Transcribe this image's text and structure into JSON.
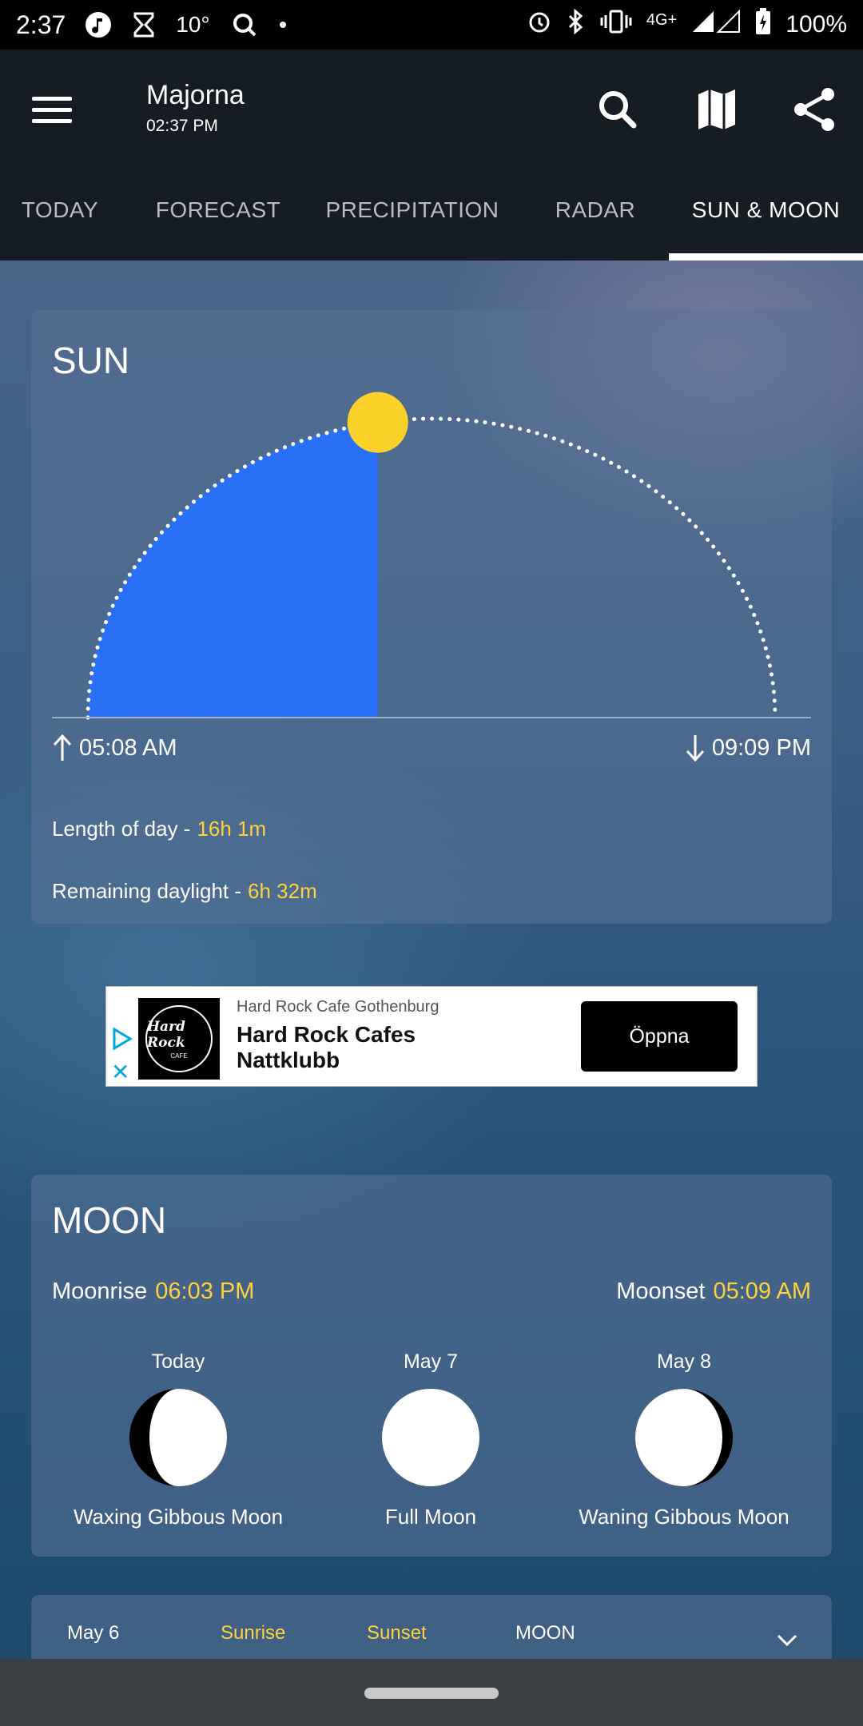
{
  "status_bar": {
    "time": "2:37",
    "temp": "10°",
    "network": "4G+",
    "battery": "100%"
  },
  "header": {
    "location": "Majorna",
    "time": "02:37 PM",
    "icons": [
      "menu-icon",
      "search-icon",
      "map-icon",
      "share-icon"
    ]
  },
  "tabs": [
    {
      "label": "TODAY"
    },
    {
      "label": "FORECAST"
    },
    {
      "label": "PRECIPITATION"
    },
    {
      "label": "RADAR"
    },
    {
      "label": "SUN & MOON",
      "active": true
    }
  ],
  "sun": {
    "title": "SUN",
    "sunrise": "05:08 AM",
    "sunset": "09:09 PM",
    "day_fraction_elapsed": 0.45,
    "length_label": "Length of day -",
    "length_value": "16h 1m",
    "remaining_label": "Remaining daylight -",
    "remaining_value": "6h 32m"
  },
  "ad": {
    "advertiser": "Hard Rock Cafe Gothenburg",
    "title": "Hard Rock Cafes Nattklubb",
    "button": "Öppna",
    "logo_text": "Hard Rock",
    "logo_sub": "CAFE"
  },
  "moon": {
    "title": "MOON",
    "moonrise_label": "Moonrise",
    "moonrise_value": "06:03 PM",
    "moonset_label": "Moonset",
    "moonset_value": "05:09 AM",
    "phases": [
      {
        "date": "Today",
        "name": "Waxing Gibbous Moon"
      },
      {
        "date": "May 7",
        "name": "Full Moon"
      },
      {
        "date": "May 8",
        "name": "Waning Gibbous Moon"
      }
    ]
  },
  "table": {
    "date": "May 6",
    "col_sunrise": "Sunrise",
    "col_sunset": "Sunset",
    "col_moon": "MOON"
  },
  "colors": {
    "accent_yellow": "#ffd23d",
    "sun_fill": "#2a6ff7",
    "appbar": "#151c24"
  }
}
